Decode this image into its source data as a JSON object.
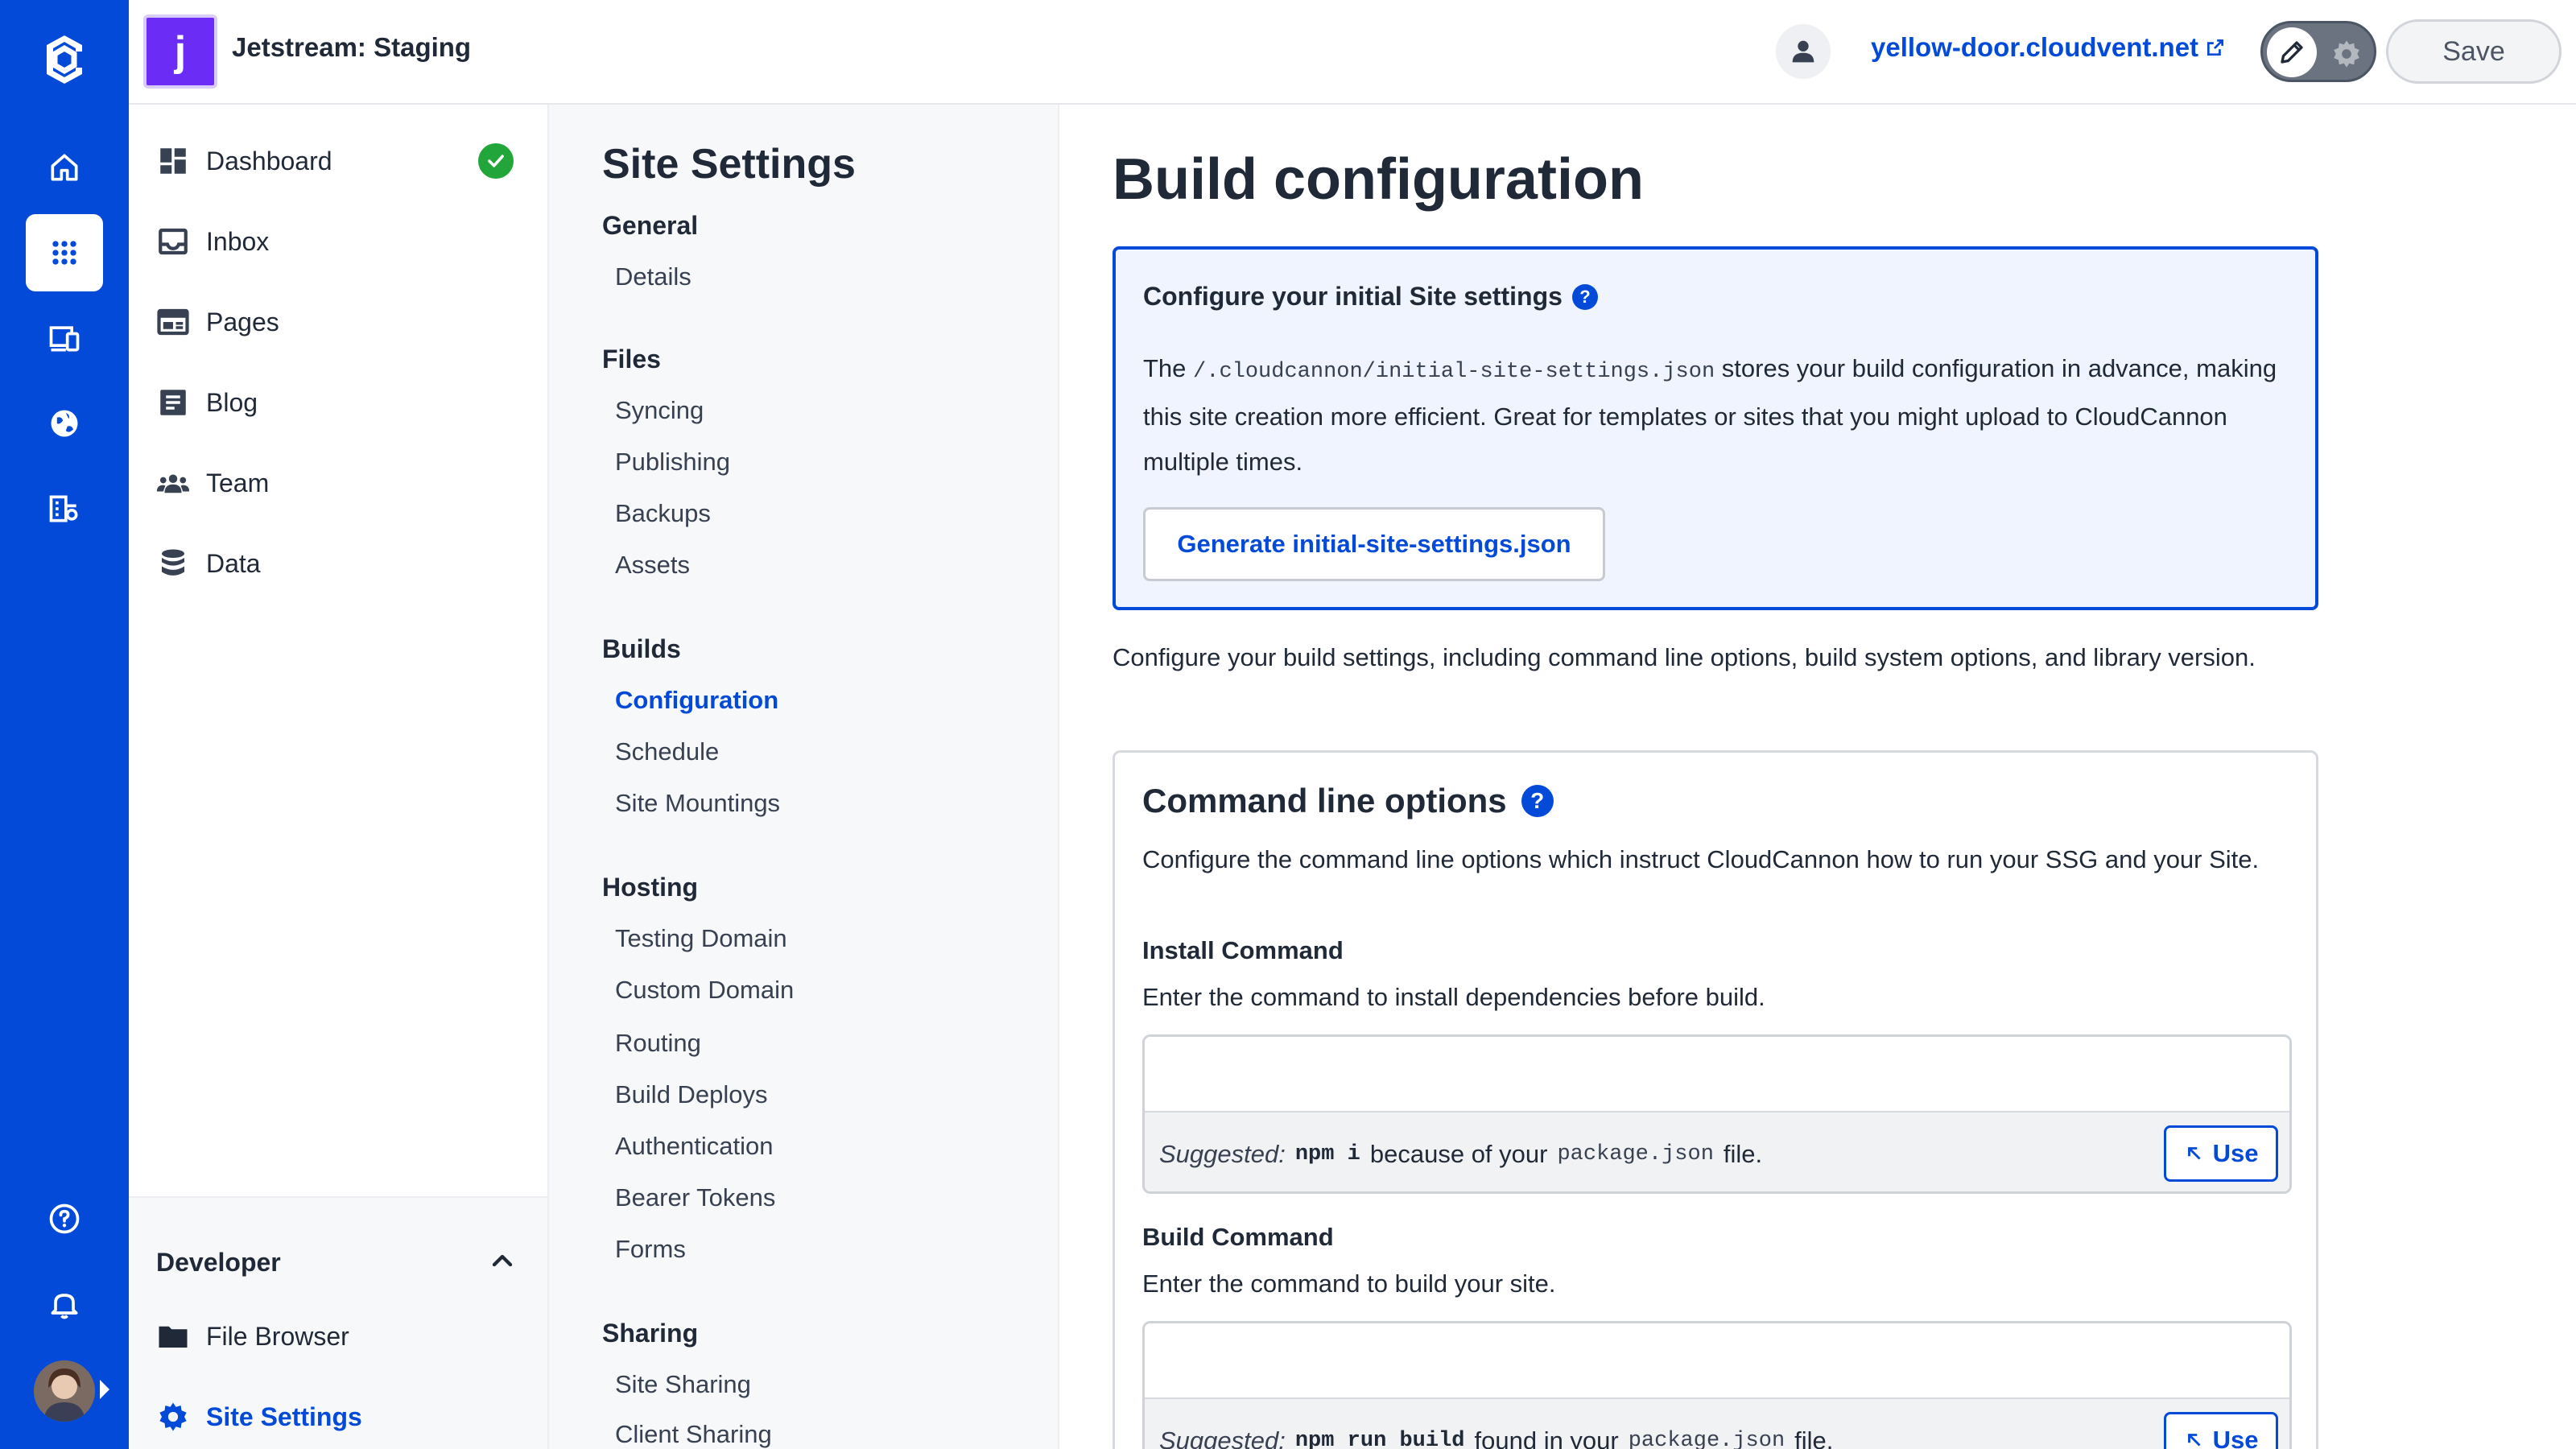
{
  "colors": {
    "brand": "#034ad8",
    "success": "#22a63a",
    "site_avatar": "#6b2df5"
  },
  "header": {
    "site_initial": "j",
    "site_name": "Jetstream: Staging",
    "site_url": "yellow-door.cloudvent.net",
    "save_label": "Save"
  },
  "rail": {
    "icons": [
      "cloudcannon-logo-icon",
      "home-icon",
      "apps-grid-icon",
      "devices-icon",
      "globe-icon",
      "organization-icon",
      "help-icon",
      "bell-icon"
    ]
  },
  "nav": {
    "items": [
      {
        "label": "Dashboard",
        "icon": "dashboard-icon"
      },
      {
        "label": "Inbox",
        "icon": "inbox-icon"
      },
      {
        "label": "Pages",
        "icon": "pages-icon"
      },
      {
        "label": "Blog",
        "icon": "blog-icon"
      },
      {
        "label": "Team",
        "icon": "team-icon"
      },
      {
        "label": "Data",
        "icon": "data-icon"
      }
    ],
    "developer": {
      "title": "Developer",
      "items": [
        {
          "label": "File Browser",
          "icon": "folder-icon"
        },
        {
          "label": "Site Settings",
          "icon": "gear-icon"
        }
      ]
    }
  },
  "settings_menu": {
    "title": "Site Settings",
    "groups": [
      {
        "label": "General",
        "items": [
          "Details"
        ]
      },
      {
        "label": "Files",
        "items": [
          "Syncing",
          "Publishing",
          "Backups",
          "Assets"
        ]
      },
      {
        "label": "Builds",
        "items": [
          "Configuration",
          "Schedule",
          "Site Mountings"
        ]
      },
      {
        "label": "Hosting",
        "items": [
          "Testing Domain",
          "Custom Domain",
          "Routing",
          "Build Deploys",
          "Authentication",
          "Bearer Tokens",
          "Forms"
        ]
      },
      {
        "label": "Sharing",
        "items": [
          "Site Sharing",
          "Client Sharing"
        ]
      }
    ],
    "active": "Configuration"
  },
  "main": {
    "title": "Build configuration",
    "info_box": {
      "title": "Configure your initial Site settings",
      "text_prefix": "The",
      "file_path": "/.cloudcannon/initial-site-settings.json",
      "text_suffix": "stores your build configuration in advance, making this site creation more efficient. Great for templates or sites that you might upload to CloudCannon multiple times.",
      "button_label": "Generate initial-site-settings.json"
    },
    "description": "Configure your build settings, including command line options, build system options, and library version.",
    "command_line": {
      "title": "Command line options",
      "description": "Configure the command line options which instruct CloudCannon how to run your SSG and your Site.",
      "install": {
        "label": "Install Command",
        "help": "Enter the command to install dependencies before build.",
        "value": "",
        "suggested_label": "Suggested:",
        "suggested_cmd": "npm i",
        "suggested_reason": "because of your",
        "suggested_file": "package.json",
        "suggested_end": "file.",
        "use_label": "Use"
      },
      "build": {
        "label": "Build Command",
        "help": "Enter the command to build your site.",
        "value": "",
        "suggested_label": "Suggested:",
        "suggested_cmd": "npm run build",
        "suggested_reason": "found in your",
        "suggested_file": "package.json",
        "suggested_end": "file.",
        "use_label": "Use"
      }
    }
  }
}
